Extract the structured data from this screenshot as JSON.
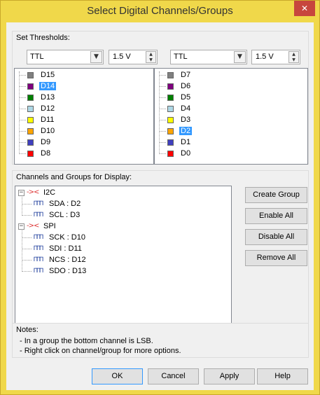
{
  "window": {
    "title": "Select Digital Channels/Groups",
    "close_glyph": "✕"
  },
  "thresholds": {
    "title": "Set Thresholds:",
    "left": {
      "standard": "TTL",
      "voltage": "1.5 V"
    },
    "right": {
      "standard": "TTL",
      "voltage": "1.5 V"
    }
  },
  "channels_left": [
    {
      "label": "D15",
      "color": "#808080",
      "selected": false
    },
    {
      "label": "D14",
      "color": "#7f007f",
      "selected": true
    },
    {
      "label": "D13",
      "color": "#008000",
      "selected": false
    },
    {
      "label": "D12",
      "color": "#add8e6",
      "selected": false
    },
    {
      "label": "D11",
      "color": "#ffff00",
      "selected": false
    },
    {
      "label": "D10",
      "color": "#ffa500",
      "selected": false
    },
    {
      "label": "D9",
      "color": "#3f3fbf",
      "selected": false
    },
    {
      "label": "D8",
      "color": "#ff0000",
      "selected": false
    }
  ],
  "channels_right": [
    {
      "label": "D7",
      "color": "#808080",
      "selected": false
    },
    {
      "label": "D6",
      "color": "#7f007f",
      "selected": false
    },
    {
      "label": "D5",
      "color": "#008000",
      "selected": false
    },
    {
      "label": "D4",
      "color": "#add8e6",
      "selected": false
    },
    {
      "label": "D3",
      "color": "#ffff00",
      "selected": false
    },
    {
      "label": "D2",
      "color": "#ffa500",
      "selected": true
    },
    {
      "label": "D1",
      "color": "#3f3fbf",
      "selected": false
    },
    {
      "label": "D0",
      "color": "#ff0000",
      "selected": false
    }
  ],
  "display": {
    "title": "Channels and Groups for Display:",
    "groups": [
      {
        "name": "I2C",
        "signals": [
          "SDA : D2",
          "SCL : D3"
        ]
      },
      {
        "name": "SPI",
        "signals": [
          "SCK : D10",
          "SDI : D11",
          "NCS : D12",
          "SDO : D13"
        ]
      }
    ],
    "group_icon": "bus-group-icon",
    "signal_icon": "waveform-icon"
  },
  "side_buttons": {
    "create_group": "Create Group",
    "enable_all": "Enable All",
    "disable_all": "Disable All",
    "remove_all": "Remove All"
  },
  "notes": {
    "title": "Notes:",
    "lines": [
      "- In a group the bottom channel is LSB.",
      "- Right click on channel/group for more options."
    ]
  },
  "bottom_buttons": {
    "ok": "OK",
    "cancel": "Cancel",
    "apply": "Apply",
    "help": "Help"
  }
}
